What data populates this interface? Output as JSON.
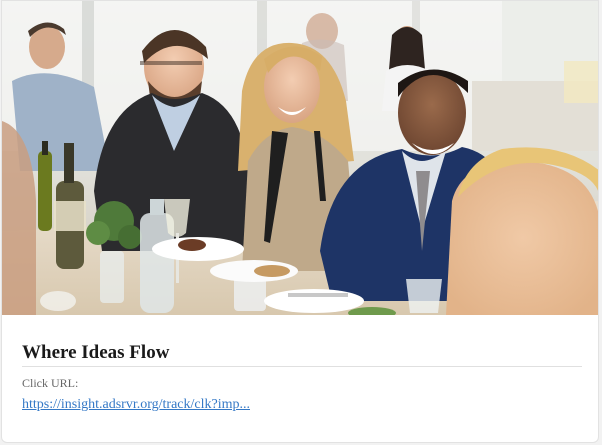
{
  "card": {
    "image_description_icon": "photo-restaurant-group-icon",
    "title": "Where Ideas Flow",
    "url_label": "Click URL:",
    "url_text": "https://insight.adsrvr.org/track/clk?imp..."
  },
  "colors": {
    "link": "#3478c6",
    "title": "#1a1a1a",
    "label": "#666666",
    "divider": "#e0e0e0"
  }
}
